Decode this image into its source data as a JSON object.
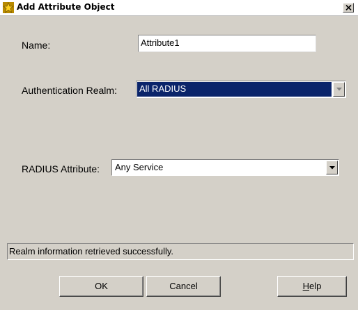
{
  "window": {
    "title": "Add Attribute Object",
    "close_glyph": "✕",
    "title_icon": "gold-star-icon"
  },
  "form": {
    "name_label": "Name:",
    "name_value": "Attribute1",
    "realm_label": "Authentication Realm:",
    "realm_value": "All RADIUS",
    "radius_label": "RADIUS Attribute:",
    "radius_value": "Any Service"
  },
  "status": {
    "message": "Realm information retrieved successfully."
  },
  "buttons": {
    "ok_label": "OK",
    "cancel_label": "Cancel",
    "help_mnemonic": "H",
    "help_rest": "elp"
  },
  "colors": {
    "dialog_bg": "#d4d0c8",
    "selection_bg": "#0a246a",
    "title_icon": "#f2c200"
  }
}
